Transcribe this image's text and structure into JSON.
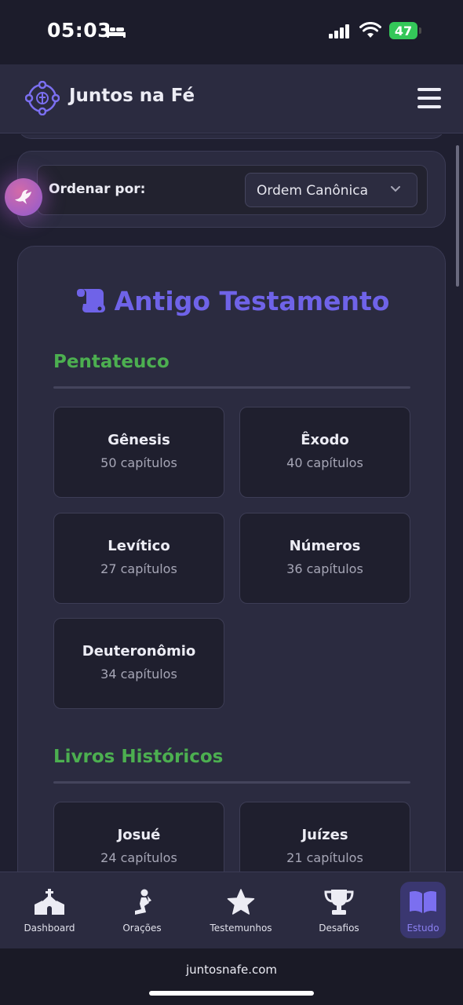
{
  "status_bar": {
    "time": "05:03",
    "battery": "47",
    "sleep_icon": "bed-icon",
    "signal_icon": "cellular-signal-icon",
    "wifi_icon": "wifi-icon"
  },
  "header": {
    "title": "Juntos na Fé",
    "logo_icon": "community-logo-icon",
    "menu_icon": "hamburger-menu-icon"
  },
  "sort": {
    "label": "Ordenar por:",
    "selected": "Ordem Canônica"
  },
  "testament": {
    "title": "Antigo Testamento",
    "icon": "scroll-icon",
    "sections": [
      {
        "title": "Pentateuco",
        "books": [
          {
            "name": "Gênesis",
            "chapters": "50 capítulos"
          },
          {
            "name": "Êxodo",
            "chapters": "40 capítulos"
          },
          {
            "name": "Levítico",
            "chapters": "27 capítulos"
          },
          {
            "name": "Números",
            "chapters": "36 capítulos"
          },
          {
            "name": "Deuteronômio",
            "chapters": "34 capítulos"
          }
        ]
      },
      {
        "title": "Livros Históricos",
        "books": [
          {
            "name": "Josué",
            "chapters": "24 capítulos"
          },
          {
            "name": "Juízes",
            "chapters": "21 capítulos"
          }
        ]
      }
    ]
  },
  "nav": {
    "items": [
      {
        "label": "Dashboard",
        "icon": "church-icon"
      },
      {
        "label": "Orações",
        "icon": "praying-person-icon"
      },
      {
        "label": "Testemunhos",
        "icon": "star-icon"
      },
      {
        "label": "Desafios",
        "icon": "trophy-icon"
      },
      {
        "label": "Estudo",
        "icon": "open-book-icon"
      }
    ],
    "active": "Estudo"
  },
  "browser": {
    "url": "juntosnafe.com"
  },
  "colors": {
    "accent": "#6f63e8",
    "section_heading": "#4caf50",
    "background": "#1f1f30",
    "card": "#2b2b40"
  }
}
